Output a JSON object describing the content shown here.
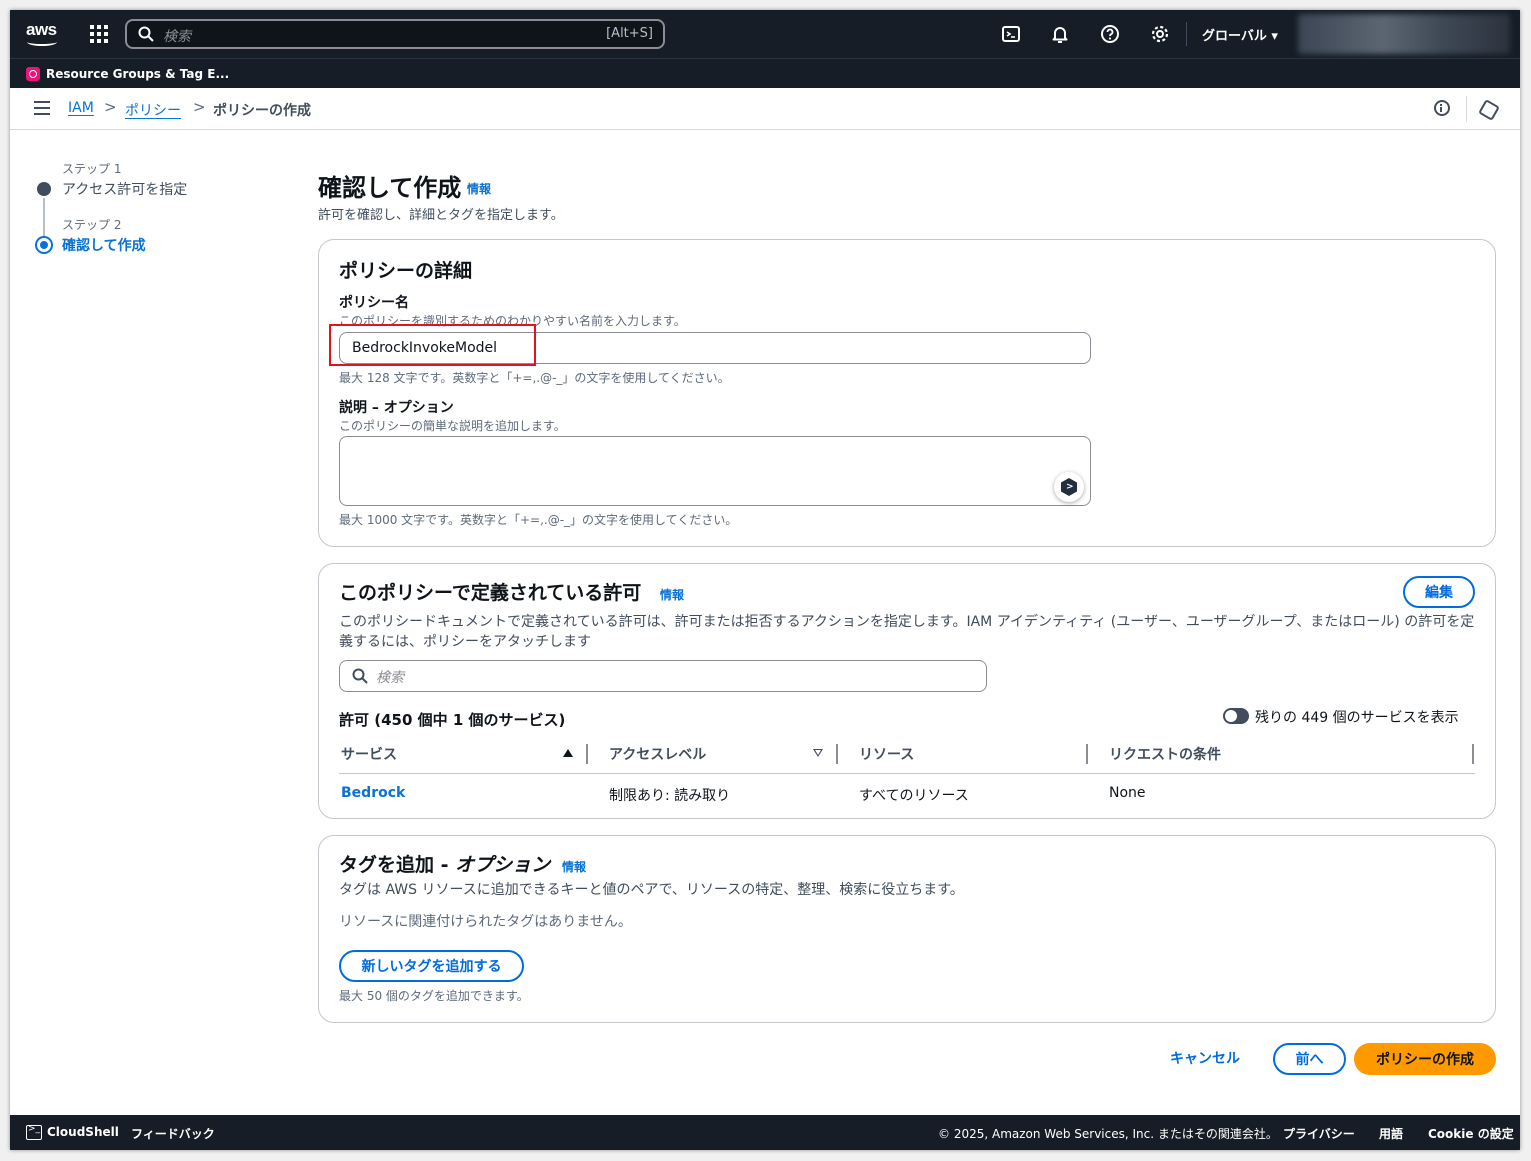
{
  "topnav": {
    "logo_text": "aws",
    "search_placeholder": "検索",
    "search_shortcut": "[Alt+S]",
    "region": "グローバル ▾"
  },
  "favorites": {
    "items": [
      {
        "label": "Resource Groups & Tag E..."
      }
    ]
  },
  "breadcrumb": {
    "items": [
      {
        "label": "IAM"
      },
      {
        "label": "ポリシー"
      }
    ],
    "separator": ">",
    "current": "ポリシーの作成"
  },
  "steps": [
    {
      "label": "ステップ 1",
      "name": "アクセス許可を指定",
      "state": "complete"
    },
    {
      "label": "ステップ 2",
      "name": "確認して作成",
      "state": "current"
    }
  ],
  "page": {
    "title": "確認して作成",
    "info": "情報",
    "description": "許可を確認し、詳細とタグを指定します。"
  },
  "details": {
    "heading": "ポリシーの詳細",
    "name_label": "ポリシー名",
    "name_desc": "このポリシーを識別するためのわかりやすい名前を入力します。",
    "name_value": "BedrockInvokeModel",
    "name_hint": "最大 128 文字です。英数字と「+=,.@-_」の文字を使用してください。",
    "desc_label": "説明 – オプション",
    "desc_desc": "このポリシーの簡単な説明を追加します。",
    "desc_value": "",
    "desc_hint": "最大 1000 文字です。英数字と「+=,.@-_」の文字を使用してください。"
  },
  "permissions": {
    "heading": "このポリシーで定義されている許可",
    "info": "情報",
    "edit_label": "編集",
    "description": "このポリシードキュメントで定義されている許可は、許可または拒否するアクションを指定します。IAM アイデンティティ (ユーザー、ユーザーグループ、またはロール) の許可を定義するには、ポリシーをアタッチします",
    "search_placeholder": "検索",
    "count_label": "許可 (450 個中 1 個のサービス)",
    "toggle_label": "残りの 449 個のサービスを表示",
    "toggle_on": false,
    "columns": [
      "サービス",
      "アクセスレベル",
      "リソース",
      "リクエストの条件"
    ],
    "rows": [
      {
        "service": "Bedrock",
        "access_level": "制限あり: 読み取り",
        "resource": "すべてのリソース",
        "condition": "None"
      }
    ]
  },
  "tags": {
    "heading_main": "タグを追加 - ",
    "heading_option": "オプション",
    "info": "情報",
    "description": "タグは AWS リソースに追加できるキーと値のペアで、リソースの特定、整理、検索に役立ちます。",
    "empty_text": "リソースに関連付けられたタグはありません。",
    "add_button": "新しいタグを追加する",
    "hint": "最大 50 個のタグを追加できます。"
  },
  "actions": {
    "cancel": "キャンセル",
    "previous": "前へ",
    "create": "ポリシーの作成"
  },
  "footer": {
    "cloudshell": "CloudShell",
    "feedback": "フィードバック",
    "copyright": "© 2025, Amazon Web Services, Inc. またはその関連会社。",
    "privacy": "プライバシー",
    "terms": "用語",
    "cookies": "Cookie の設定"
  },
  "colors": {
    "nav_bg": "#161d26",
    "link": "#0972d3",
    "primary_button": "#ff9900",
    "highlight_box": "#e0141e"
  }
}
